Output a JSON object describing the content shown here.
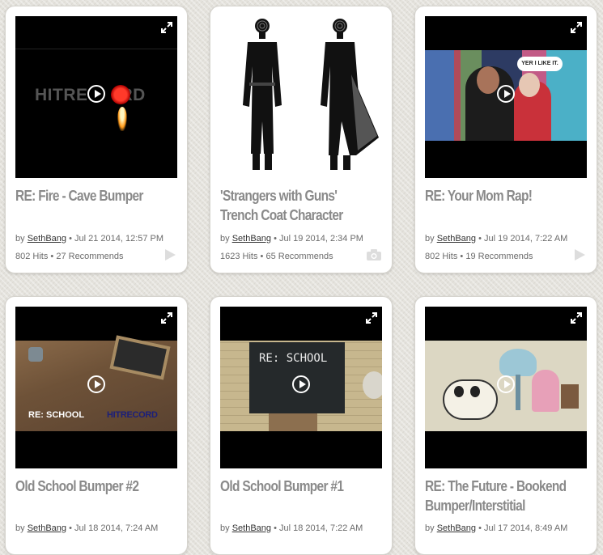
{
  "cards": [
    {
      "title": "RE: Fire - Cave Bumper",
      "by": "by",
      "user": "SethBang",
      "date": "Jul 21 2014, 12:57 PM",
      "hits": "802 Hits",
      "recommends": "27 Recommends",
      "media_type": "video",
      "thumb_text_left": "HITRE",
      "thumb_text_right": "RD"
    },
    {
      "title": "'Strangers with Guns' Trench Coat Character",
      "by": "by",
      "user": "SethBang",
      "date": "Jul 19 2014, 2:34 PM",
      "hits": "1623 Hits",
      "recommends": "65 Recommends",
      "media_type": "image"
    },
    {
      "title": "RE: Your Mom Rap!",
      "by": "by",
      "user": "SethBang",
      "date": "Jul 19 2014, 7:22 AM",
      "hits": "802 Hits",
      "recommends": "19 Recommends",
      "media_type": "video",
      "thumb_bubble": "YER I LIKE IT."
    },
    {
      "title": "Old School Bumper #2",
      "by": "by",
      "user": "SethBang",
      "date": "Jul 18 2014, 7:24 AM",
      "media_type": "video",
      "thumb_text_left": "RE: SCHOOL",
      "thumb_text_right": "HITRECORD"
    },
    {
      "title": "Old School Bumper #1",
      "by": "by",
      "user": "SethBang",
      "date": "Jul 18 2014, 7:22 AM",
      "media_type": "video",
      "thumb_chalk": "RE: SCHOOL"
    },
    {
      "title": "RE: The Future - Bookend Bumper/Interstitial",
      "by": "by",
      "user": "SethBang",
      "date": "Jul 17 2014, 8:49 AM",
      "media_type": "video"
    }
  ],
  "icons": {
    "expand": "expand-icon",
    "play": "play-icon",
    "camera": "camera-icon"
  },
  "colors": {
    "title": "#8a8a8a",
    "meta": "#6b6b6b",
    "background": "#e4e2dc"
  }
}
